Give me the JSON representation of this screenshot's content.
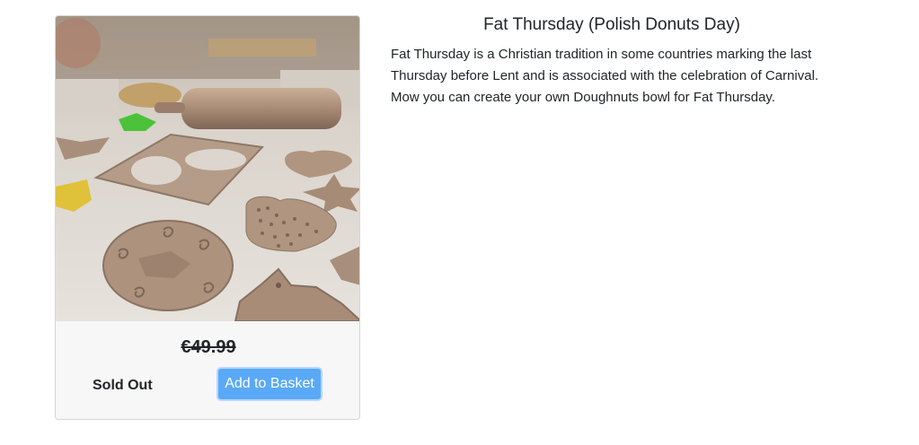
{
  "product": {
    "price": "€49.99",
    "status": "Sold Out",
    "basket_button": "Add to Basket",
    "image_alt": "Clay pieces cut into shapes on a workshop table"
  },
  "details": {
    "title": "Fat Thursday (Polish Donuts Day)",
    "description": "Fat Thursday is a Christian tradition in some countries marking the last Thursday before Lent and is associated with the celebration of Carnival. Mow you can create your own Doughnuts bowl for Fat Thursday."
  },
  "colors": {
    "button_bg": "#5aa9f7",
    "card_bg": "#f7f7f7",
    "text": "#212529"
  }
}
